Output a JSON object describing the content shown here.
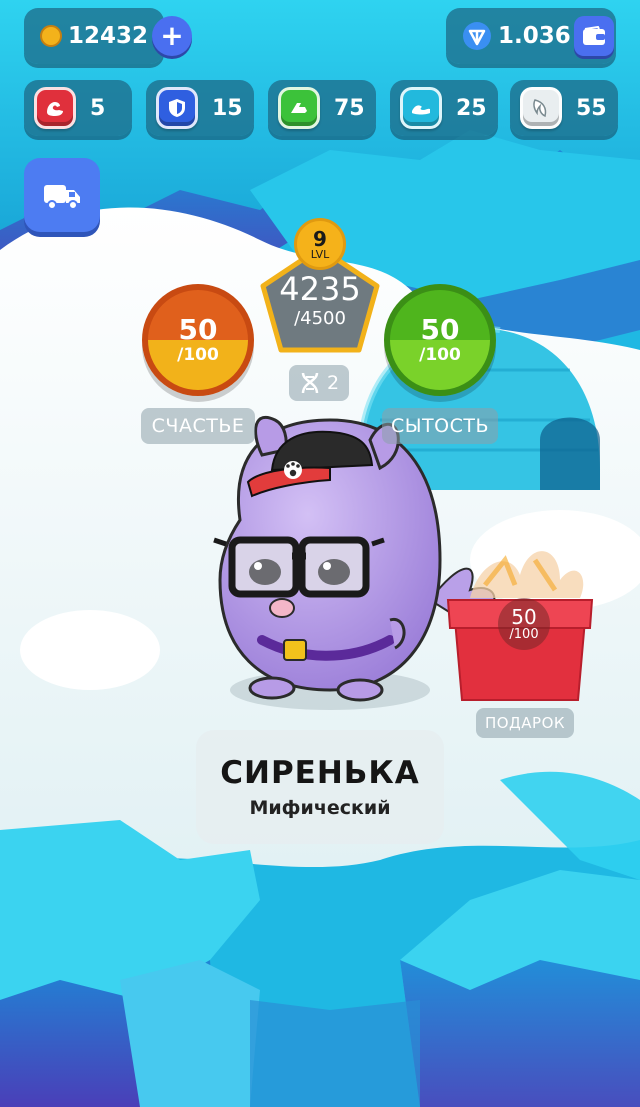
{
  "currency": {
    "coins": "12432",
    "ton_balance": "1.036",
    "coin_icon": "coin-icon",
    "ton_icon": "ton-icon",
    "wallet_icon": "wallet-icon",
    "add_icon": "plus-icon"
  },
  "stats": [
    {
      "icon": "strength-icon",
      "value": "5",
      "color": "#e0303c"
    },
    {
      "icon": "shield-icon",
      "value": "15",
      "color": "#2f5fe0"
    },
    {
      "icon": "speed-icon",
      "value": "75",
      "color": "#3cc23a"
    },
    {
      "icon": "wave-icon",
      "value": "25",
      "color": "#22b9dd"
    },
    {
      "icon": "feather-icon",
      "value": "55",
      "color": "#cfd8dc"
    }
  ],
  "delivery": {
    "icon": "truck-icon"
  },
  "level": {
    "value": "9",
    "label": "LVL",
    "xp_current": "4235",
    "xp_total": "/4500",
    "dna_count": "2",
    "dna_icon": "dna-icon"
  },
  "happiness": {
    "value": "50",
    "max": "/100",
    "label": "СЧАСТЬЕ",
    "colors": [
      "#e0601c",
      "#f2b21a"
    ]
  },
  "satiety": {
    "value": "50",
    "max": "/100",
    "label": "СЫТОСТЬ",
    "colors": [
      "#4fb51d",
      "#7ad22a"
    ]
  },
  "gift": {
    "value": "50",
    "max": "/100",
    "label": "ПОДАРОК"
  },
  "pet": {
    "name": "СИРЕНЬКА",
    "rarity": "Мифический",
    "color": "#b79be6"
  }
}
